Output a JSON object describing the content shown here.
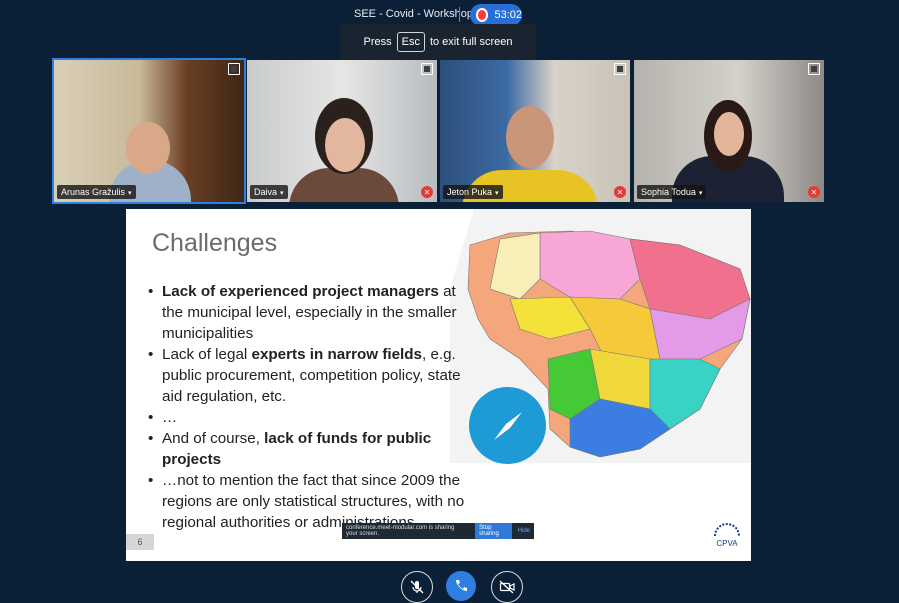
{
  "meeting": {
    "title": "SEE - Covid - Workshop",
    "recording_time": "53:02"
  },
  "fullscreen_hint": {
    "prefix": "Press",
    "key": "Esc",
    "suffix": "to exit full screen"
  },
  "participants": [
    {
      "name": "Arunas Gražulis",
      "muted": false,
      "active": true
    },
    {
      "name": "Daiva",
      "muted": true,
      "active": false
    },
    {
      "name": "Jeton Puka",
      "muted": true,
      "active": false
    },
    {
      "name": "Sophia Todua",
      "muted": true,
      "active": false
    }
  ],
  "slide": {
    "title": "Challenges",
    "bullets": [
      {
        "bold": "Lack of experienced project managers",
        "rest": " at the municipal level, especially in the smaller municipalities"
      },
      {
        "pre": "Lack of legal ",
        "bold": "experts in narrow fields",
        "rest": ", e.g. public procurement, competition policy, state aid regulation, etc."
      },
      {
        "pre": "…"
      },
      {
        "pre": "And of course, ",
        "bold": "lack of funds for public projects"
      },
      {
        "pre": "…not to mention the fact that since 2009 the regions are only statistical structures, with no regional authorities or administrations"
      }
    ],
    "page_number": "6",
    "logo_text": "CPVA"
  },
  "screen_share": {
    "message": "conference.meet-modular.com is sharing your screen.",
    "stop_label": "Stop sharing",
    "hide_label": "Hide"
  },
  "colors": {
    "background": "#0b2036",
    "accent": "#2f7fe0",
    "mute_red": "#e53935",
    "compass_blue": "#1e9ad6"
  }
}
